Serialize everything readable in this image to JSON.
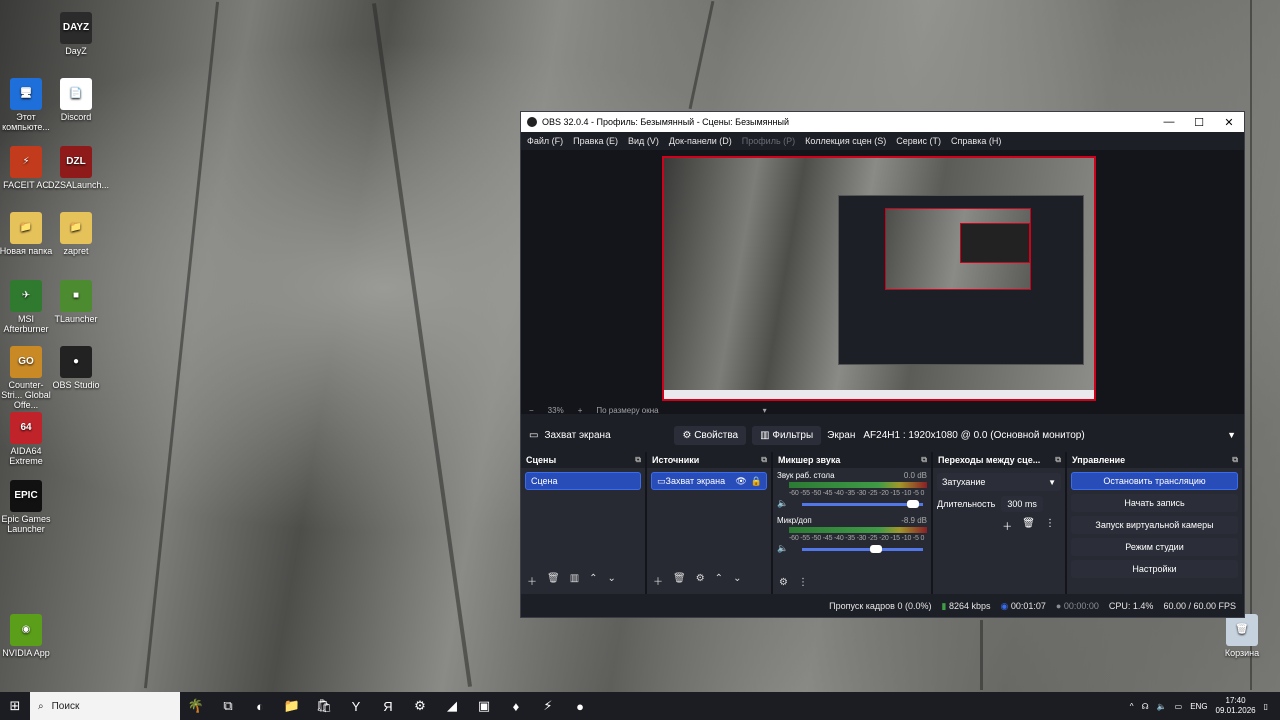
{
  "desktop": {
    "icons": [
      {
        "label": "DayZ",
        "glyph": "DAYZ",
        "color": "#2b2b2b"
      },
      {
        "label": "Этот компьюте...",
        "glyph": "🖥",
        "color": "#1e6fd9"
      },
      {
        "label": "Discord",
        "glyph": "📄",
        "color": "#ffffff"
      },
      {
        "label": "FACEIT AC",
        "glyph": "⚡",
        "color": "#c23b1c"
      },
      {
        "label": "DZSALaunch...",
        "glyph": "DZL",
        "color": "#8f1a1a"
      },
      {
        "label": "Новая папка",
        "glyph": "📁",
        "color": "#e6c25b"
      },
      {
        "label": "zapret",
        "glyph": "📁",
        "color": "#e6c25b"
      },
      {
        "label": "MSI Afterburner",
        "glyph": "✈",
        "color": "#2f7a2f"
      },
      {
        "label": "TLauncher",
        "glyph": "■",
        "color": "#4c8b2f"
      },
      {
        "label": "Counter-Stri... Global Offe...",
        "glyph": "GO",
        "color": "#c98a26"
      },
      {
        "label": "OBS Studio",
        "glyph": "●",
        "color": "#222222"
      },
      {
        "label": "AIDA64 Extreme",
        "glyph": "64",
        "color": "#c0242a"
      },
      {
        "label": "Epic Games Launcher",
        "glyph": "EPIC",
        "color": "#111111"
      },
      {
        "label": "NVIDIA App",
        "glyph": "◉",
        "color": "#5a9e1a"
      },
      {
        "label": "Корзина",
        "glyph": "🗑",
        "color": "#c6d3df"
      }
    ]
  },
  "window": {
    "title": "OBS 32.0.4 - Профиль: Безымянный - Сцены: Безымянный",
    "controls": {
      "minimize": "—",
      "maximize": "☐",
      "close": "✕"
    },
    "menu": [
      {
        "label": "Файл (F)",
        "disabled": false
      },
      {
        "label": "Правка (E)",
        "disabled": false
      },
      {
        "label": "Вид (V)",
        "disabled": false
      },
      {
        "label": "Док-панели (D)",
        "disabled": false
      },
      {
        "label": "Профиль (P)",
        "disabled": true
      },
      {
        "label": "Коллекция сцен (S)",
        "disabled": false
      },
      {
        "label": "Сервис (T)",
        "disabled": false
      },
      {
        "label": "Справка (H)",
        "disabled": false
      }
    ]
  },
  "preview": {
    "zoom_minus": "−",
    "zoom_level": "33%",
    "zoom_plus": "+",
    "fit_label": "По размеру окна",
    "fit_caret": "▾"
  },
  "source_bar": {
    "source_name": "Захват экрана",
    "properties_label": "Свойства",
    "filters_label": "Фильтры",
    "screen_label": "Экран",
    "monitor_value": "AF24H1    : 1920x1080 @ 0.0 (Основной монитор)"
  },
  "docks": {
    "scenes": {
      "title": "Сцены",
      "items": [
        "Сцена"
      ]
    },
    "sources": {
      "title": "Источники",
      "items": [
        "Захват экрана"
      ]
    },
    "mixer": {
      "title": "Микшер звука",
      "channels": [
        {
          "name": "Звук раб. стола",
          "db": "0.0 dB",
          "volume": 0.97
        },
        {
          "name": "Микр/доп",
          "db": "-8.9 dB",
          "volume": 0.66
        }
      ],
      "scale": "-60 -55 -50 -45 -40 -35 -30 -25 -20 -15 -10 -5 0"
    },
    "transitions": {
      "title": "Переходы между сце...",
      "selected": "Затухание",
      "duration_label": "Длительность",
      "duration_value": "300 ms"
    },
    "controls": {
      "title": "Управление",
      "buttons": [
        {
          "label": "Остановить трансляцию",
          "primary": true
        },
        {
          "label": "Начать запись",
          "primary": false
        },
        {
          "label": "Запуск виртуальной камеры",
          "primary": false
        },
        {
          "label": "Режим студии",
          "primary": false
        },
        {
          "label": "Настройки",
          "primary": false
        }
      ]
    }
  },
  "status": {
    "dropped": "Пропуск кадров 0 (0.0%)",
    "bitrate": "8264 kbps",
    "stream_time": "00:01:07",
    "rec_time": "00:00:00",
    "cpu": "CPU: 1.4%",
    "fps": "60.00 / 60.00 FPS"
  },
  "taskbar": {
    "search_placeholder": "Поиск",
    "lang": "ENG",
    "time": "17:40",
    "date": "09.01.2026"
  },
  "colors": {
    "accent": "#284cb8",
    "record_red": "#d0021b"
  }
}
